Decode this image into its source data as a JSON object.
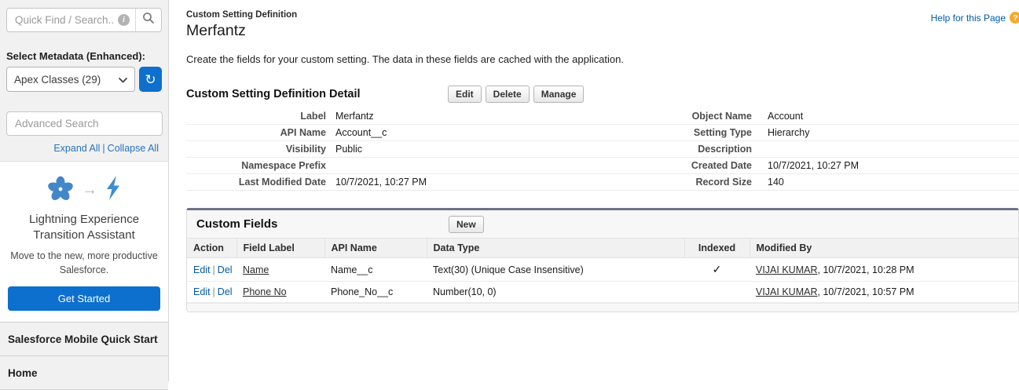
{
  "sidebar": {
    "quick_find_placeholder": "Quick Find / Search...",
    "metadata_label": "Select Metadata (Enhanced):",
    "metadata_selected": "Apex Classes (29)",
    "advanced_search_placeholder": "Advanced Search",
    "expand_all": "Expand All",
    "collapse_all": "Collapse All",
    "links_separator": "|",
    "lightning": {
      "title_line1": "Lightning Experience",
      "title_line2": "Transition Assistant",
      "subtitle": "Move to the new, more productive Salesforce.",
      "button": "Get Started"
    },
    "sections": [
      "Salesforce Mobile Quick Start",
      "Home"
    ]
  },
  "header": {
    "breadcrumb": "Custom Setting Definition",
    "title": "Merfantz",
    "help_link": "Help for this Page",
    "help_glyph": "?",
    "description": "Create the fields for your custom setting. The data in these fields are cached with the application."
  },
  "detail": {
    "title": "Custom Setting Definition Detail",
    "buttons": [
      "Edit",
      "Delete",
      "Manage"
    ],
    "rows": [
      {
        "l1": "Label",
        "v1": "Merfantz",
        "l2": "Object Name",
        "v2": "Account"
      },
      {
        "l1": "API Name",
        "v1": "Account__c",
        "l2": "Setting Type",
        "v2": "Hierarchy"
      },
      {
        "l1": "Visibility",
        "v1": "Public",
        "l2": "Description",
        "v2": ""
      },
      {
        "l1": "Namespace Prefix",
        "v1": "",
        "l2": "Created Date",
        "v2": "10/7/2021, 10:27 PM"
      },
      {
        "l1": "Last Modified Date",
        "v1": "10/7/2021, 10:27 PM",
        "l2": "Record Size",
        "v2": "140"
      }
    ]
  },
  "custom_fields": {
    "title": "Custom Fields",
    "new_button": "New",
    "action_separator": "|",
    "columns": [
      "Action",
      "Field Label",
      "API Name",
      "Data Type",
      "Indexed",
      "Modified By"
    ],
    "rows": [
      {
        "edit": "Edit",
        "del": "Del",
        "field_label": "Name",
        "api_name": "Name__c",
        "data_type": "Text(30) (Unique Case Insensitive)",
        "indexed": "✓",
        "modified_user": "VIJAI KUMAR",
        "modified_date": ", 10/7/2021, 10:28 PM"
      },
      {
        "edit": "Edit",
        "del": "Del",
        "field_label": "Phone No",
        "api_name": "Phone_No__c",
        "data_type": "Number(10, 0)",
        "indexed": "",
        "modified_user": "VIJAI KUMAR",
        "modified_date": ", 10/7/2021, 10:57 PM"
      }
    ]
  },
  "icons": {
    "arrow": "→",
    "refresh": "↻"
  },
  "colors": {
    "accent_blue": "#0d6fce",
    "link_blue": "#015ba7",
    "sidebar_link_blue": "#2672be",
    "panel_top_border": "#6e7287",
    "help_icon_orange": "#f6a828",
    "sidebar_bg": "#f1f1f1"
  }
}
